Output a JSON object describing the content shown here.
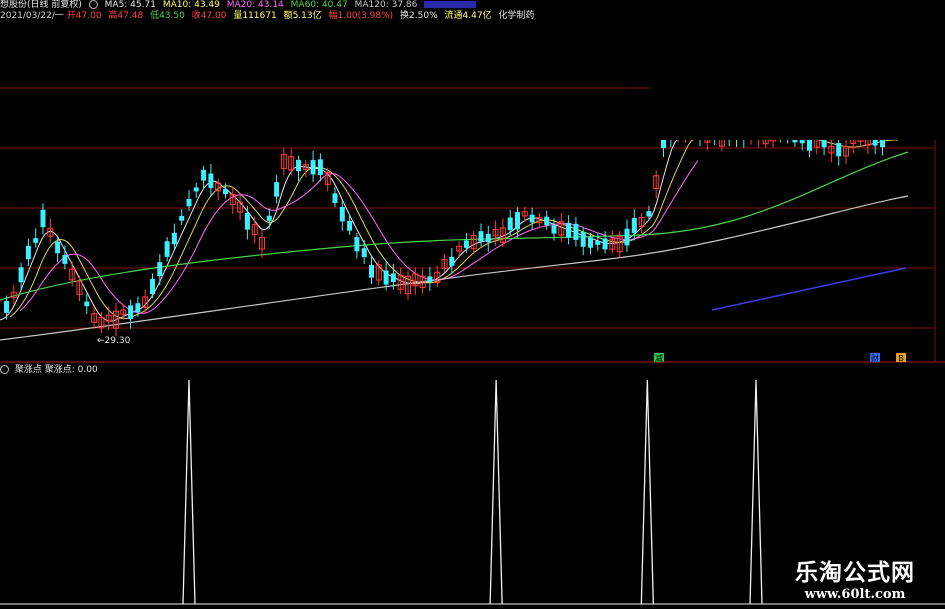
{
  "header": {
    "row1": {
      "stock": "想股份(日线 前复权)",
      "ma5": "MA5: 45.71",
      "ma10": "MA10: 43.49",
      "ma20": "MA20: 43.14",
      "ma60": "MA60: 40.47",
      "ma120": "MA120: 37.86"
    },
    "row2": {
      "date": "2021/03/22/一",
      "open": "开47.00",
      "high": "高47.48",
      "low": "低43.50",
      "close": "收47.00",
      "volume": "量111671",
      "amount": "额5.13亿",
      "change": "幅1.00(3.98%)",
      "turnover": "换2.50%",
      "float": "流通4.47亿",
      "sector": "化学制药"
    }
  },
  "chart_label": "←29.30",
  "indicator": {
    "name": "聚涨点",
    "value_label": "聚涨点: 0.00"
  },
  "signal_badges": [
    "减",
    "财",
    "B"
  ],
  "watermark": {
    "name": "乐淘公式网",
    "url": "www.60lt.com"
  },
  "colors": {
    "up": "#ff3c3c",
    "down": "#3cf0ff",
    "ma5": "#e8e8e8",
    "ma10": "#ffff66",
    "ma20": "#ff66ff",
    "ma60": "#4cd24c",
    "ma120": "#c8c8c8",
    "grid": "#7a1010"
  },
  "chart_data": {
    "type": "candlestick",
    "main_series": [
      {
        "name": "MA5"
      },
      {
        "name": "MA10"
      },
      {
        "name": "MA20"
      },
      {
        "name": "MA60"
      },
      {
        "name": "MA120"
      }
    ],
    "indicator_series": {
      "name": "聚涨点",
      "spike_positions": [
        0.2,
        0.525,
        0.685,
        0.8
      ]
    }
  }
}
